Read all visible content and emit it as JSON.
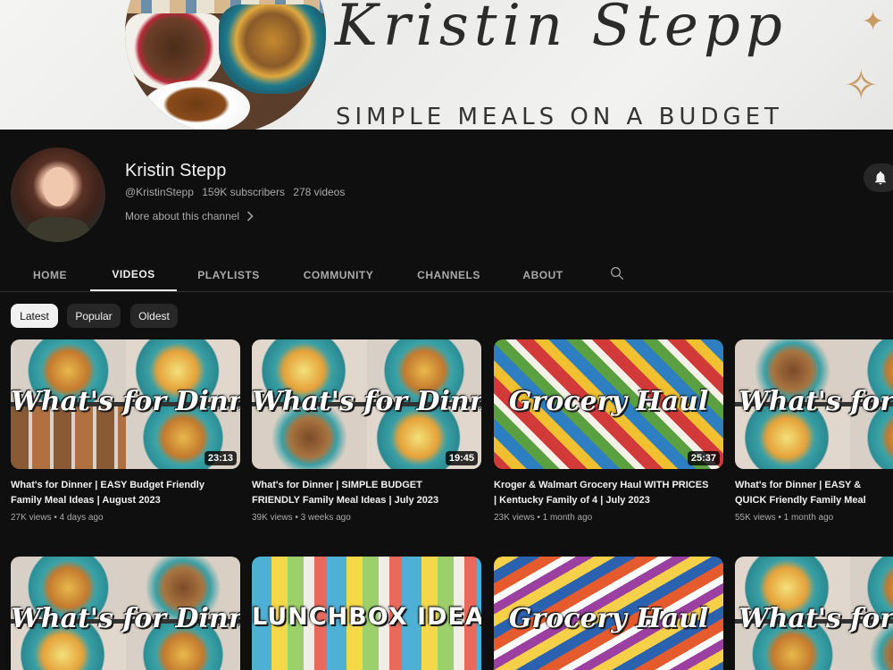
{
  "banner": {
    "title": "Kristin Stepp",
    "subtitle": "SIMPLE MEALS ON A BUDGET"
  },
  "channel": {
    "name": "Kristin Stepp",
    "handle": "@KristinStepp",
    "subscribers": "159K subscribers",
    "videos_count": "278 videos",
    "more_label": "More about this channel"
  },
  "tabs": [
    {
      "label": "HOME"
    },
    {
      "label": "VIDEOS",
      "active": true
    },
    {
      "label": "PLAYLISTS"
    },
    {
      "label": "COMMUNITY"
    },
    {
      "label": "CHANNELS"
    },
    {
      "label": "ABOUT"
    }
  ],
  "chips": [
    {
      "label": "Latest",
      "active": true
    },
    {
      "label": "Popular"
    },
    {
      "label": "Oldest"
    }
  ],
  "videos": [
    {
      "overlay": "What's for Dinner?",
      "duration": "23:13",
      "title": "What's for Dinner | EASY Budget Friendly Family Meal Ideas | August 2023",
      "views": "27K views",
      "age": "4 days ago"
    },
    {
      "overlay": "What's for Dinner?",
      "duration": "19:45",
      "title": "What's for Dinner | SIMPLE BUDGET FRIENDLY Family Meal Ideas | July 2023",
      "views": "39K views",
      "age": "3 weeks ago"
    },
    {
      "overlay": "Grocery Haul",
      "duration": "25:37",
      "title": "Kroger & Walmart Grocery Haul WITH PRICES | Kentucky Family of 4 | July 2023",
      "views": "23K views",
      "age": "1 month ago"
    },
    {
      "overlay": "What's for Di",
      "duration": "",
      "title": "What's for Dinner | EASY & QUICK Friendly Family Meal Ideas | Best",
      "views": "55K views",
      "age": "1 month ago"
    },
    {
      "overlay": "What's for Dinner?",
      "duration": "",
      "title": "",
      "views": "",
      "age": ""
    },
    {
      "overlay": "LUNCHBOX IDEAS",
      "duration": "",
      "title": "",
      "views": "",
      "age": ""
    },
    {
      "overlay": "Grocery Haul",
      "duration": "",
      "title": "",
      "views": "",
      "age": ""
    },
    {
      "overlay": "What's for Di",
      "duration": "",
      "title": "",
      "views": "",
      "age": ""
    }
  ],
  "icons": {
    "bell": "bell-icon",
    "search": "search-icon",
    "chevron": "chevron-right-icon"
  },
  "colors": {
    "background": "#0f0f0f",
    "text": "#f1f1f1",
    "muted": "#aaaaaa",
    "chip": "#272727"
  }
}
